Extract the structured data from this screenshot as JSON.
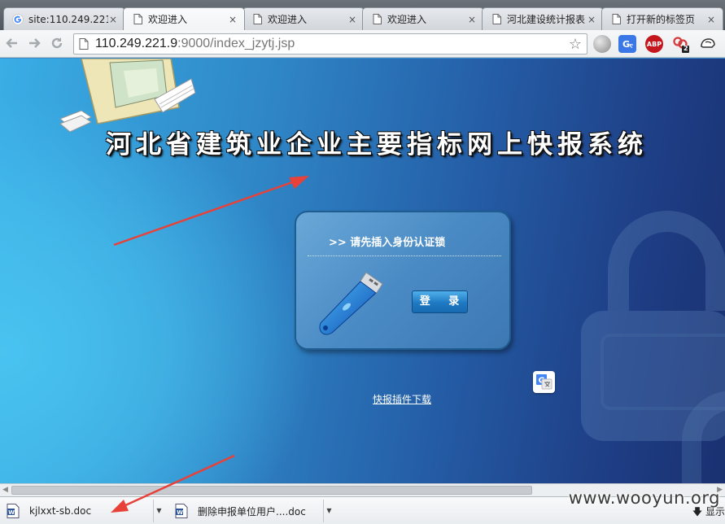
{
  "browser": {
    "tabs": [
      {
        "title": "site:110.249.221",
        "favicon": "google-g-icon",
        "active": false
      },
      {
        "title": "欢迎进入",
        "favicon": "page-icon",
        "active": true
      },
      {
        "title": "欢迎进入",
        "favicon": "page-icon",
        "active": false
      },
      {
        "title": "欢迎进入",
        "favicon": "page-icon",
        "active": false
      },
      {
        "title": "河北建设统计报表",
        "favicon": "page-icon",
        "active": false
      },
      {
        "title": "打开新的标签页",
        "favicon": "page-icon",
        "active": false
      }
    ],
    "close_glyph": "×",
    "address": {
      "host": "110.249.221.9",
      "rest": ":9000/index_jzytj.jsp"
    },
    "extensions": {
      "abp_label": "ABP",
      "badge_count": "2"
    }
  },
  "page": {
    "title": "河北省建筑业企业主要指标网上快报系统",
    "login": {
      "prompt": ">>  请先插入身份认证锁",
      "button_label": "登 录"
    },
    "plugin_link": "快报插件下载"
  },
  "downloads": {
    "items": [
      {
        "name": "kjlxxt-sb.doc",
        "icon": "word-doc-icon"
      },
      {
        "name": "删除申报单位用户....doc",
        "icon": "word-doc-icon"
      }
    ],
    "show_all_label": "显示"
  },
  "watermark": "www.wooyun.org",
  "colors": {
    "annotation_arrow": "#e8413a",
    "accent_blue": "#1f79c3"
  }
}
